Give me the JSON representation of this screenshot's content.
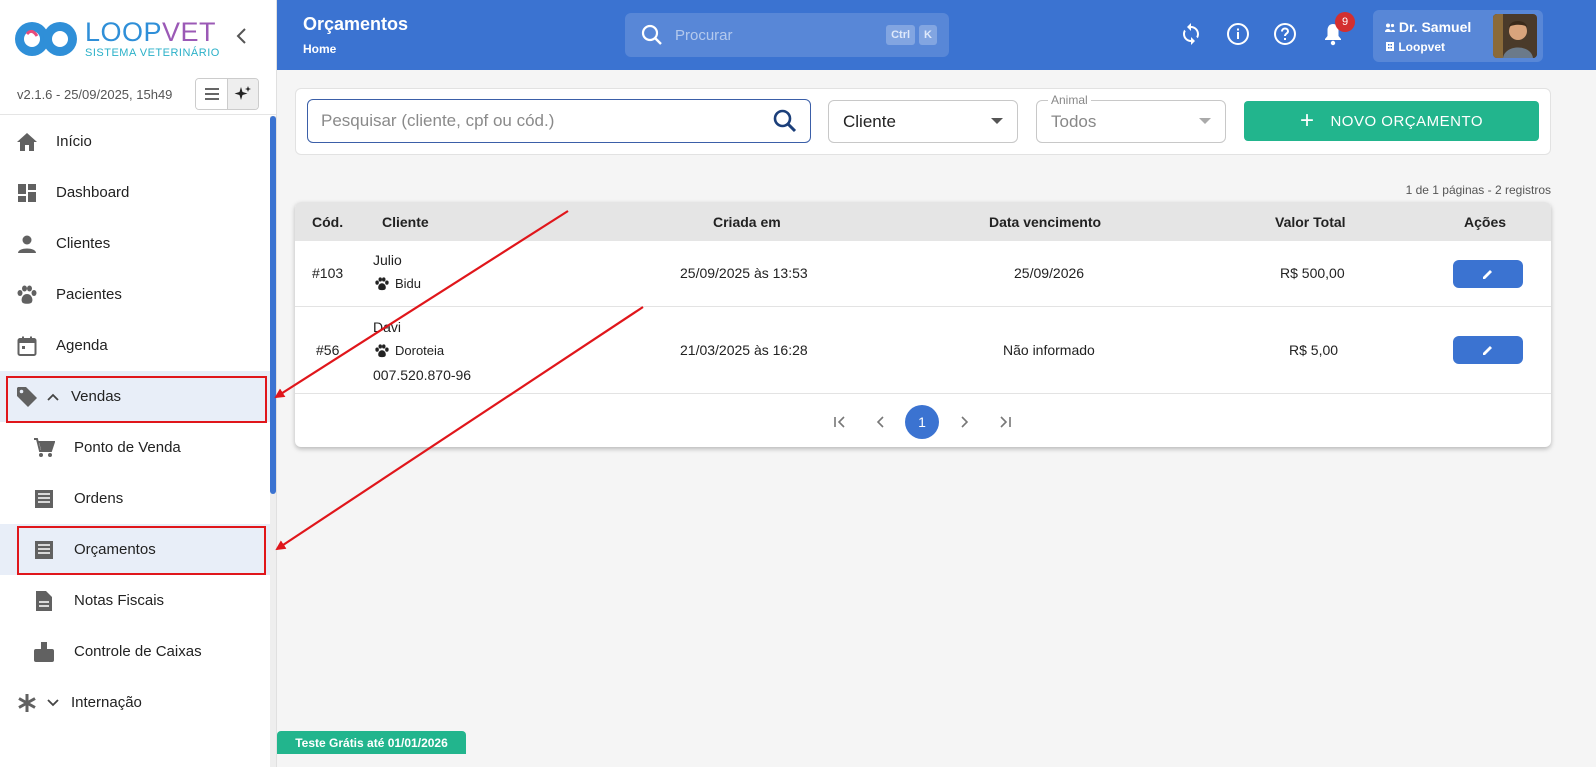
{
  "brand": {
    "name_a": "LOOP",
    "name_b": "VET",
    "subtitle": "SISTEMA VETERINÁRIO"
  },
  "version": "v2.1.6 - 25/09/2025, 15h49",
  "menu": [
    {
      "label": "Início",
      "icon": "home-icon"
    },
    {
      "label": "Dashboard",
      "icon": "dashboard-icon"
    },
    {
      "label": "Clientes",
      "icon": "person-icon"
    },
    {
      "label": "Pacientes",
      "icon": "paw-icon"
    },
    {
      "label": "Agenda",
      "icon": "calendar-icon"
    },
    {
      "label": "Vendas",
      "icon": "tag-icon",
      "expanded": true
    },
    {
      "label": "Ponto de Venda",
      "icon": "cart-icon",
      "sub": true
    },
    {
      "label": "Ordens",
      "icon": "receipt-icon",
      "sub": true
    },
    {
      "label": "Orçamentos",
      "icon": "receipt-icon",
      "sub": true,
      "active": true
    },
    {
      "label": "Notas Fiscais",
      "icon": "document-icon",
      "sub": true
    },
    {
      "label": "Controle de Caixas",
      "icon": "cash-register-icon",
      "sub": true
    },
    {
      "label": "Internação",
      "icon": "asterisk-icon",
      "expanded": false
    }
  ],
  "header": {
    "title": "Orçamentos",
    "breadcrumb": "Home",
    "search_placeholder": "Procurar",
    "shortcut_ctrl": "Ctrl",
    "shortcut_k": "K",
    "notifications": "9",
    "user_name": "Dr. Samuel",
    "user_org": "Loopvet"
  },
  "filters": {
    "search_placeholder": "Pesquisar (cliente, cpf ou cód.)",
    "client_select": "Cliente",
    "animal_label": "Animal",
    "animal_value": "Todos",
    "new_button": "NOVO ORÇAMENTO"
  },
  "page_info": "1 de 1 páginas - 2 registros",
  "table": {
    "headers": [
      "Cód.",
      "Cliente",
      "Criada em",
      "Data vencimento",
      "Valor Total",
      "Ações"
    ],
    "rows": [
      {
        "code": "#103",
        "client": "Julio",
        "pet": "Bidu",
        "doc": "",
        "created": "25/09/2025 às 13:53",
        "due": "25/09/2026",
        "total": "R$ 500,00"
      },
      {
        "code": "#56",
        "client": "Davi",
        "pet": "Doroteia",
        "doc": "007.520.870-96",
        "created": "21/03/2025 às 16:28",
        "due": "Não informado",
        "total": "R$ 5,00"
      }
    ]
  },
  "pagination": {
    "current": "1"
  },
  "trial": "Teste Grátis até 01/01/2026",
  "colors": {
    "primary": "#3b73d1",
    "accent": "#22b58d",
    "highlight": "#e0161b"
  }
}
